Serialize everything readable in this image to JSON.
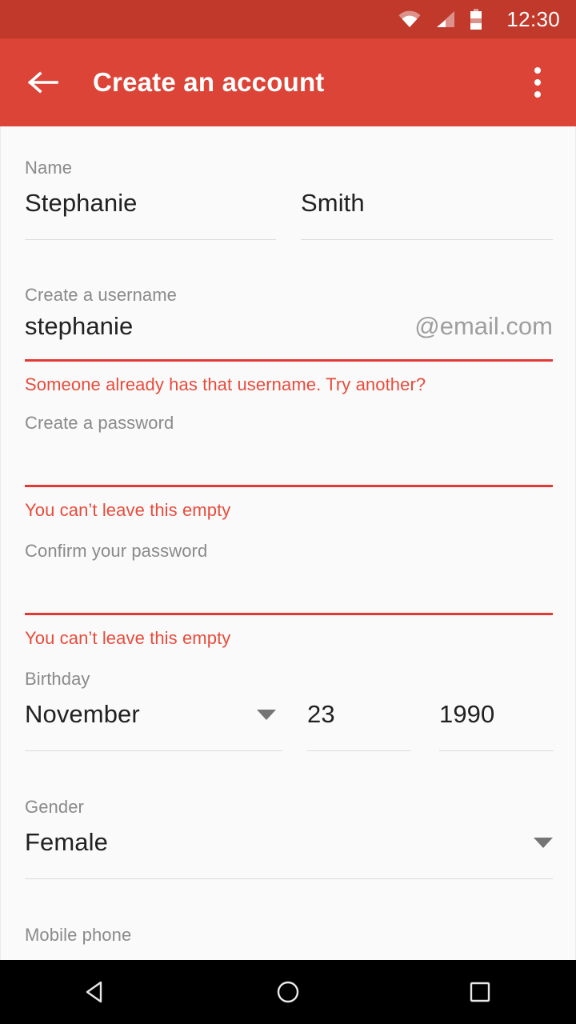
{
  "status_bar": {
    "time": "12:30",
    "background": "#c0392b",
    "icons": [
      "wifi-icon",
      "cellular-signal-icon",
      "battery-icon"
    ]
  },
  "app_bar": {
    "title": "Create an account",
    "background": "#db4437",
    "back_icon": "back-arrow-icon",
    "overflow_icon": "overflow-menu-icon"
  },
  "form": {
    "name": {
      "label": "Name",
      "first_value": "Stephanie",
      "last_value": "Smith"
    },
    "username": {
      "label": "Create a username",
      "value": "stephanie",
      "suffix": "@email.com",
      "error": "Someone already has that username. Try another?"
    },
    "password": {
      "label": "Create a password",
      "value": "",
      "error": "You can’t leave this empty"
    },
    "confirm_password": {
      "label": "Confirm your password",
      "value": "",
      "error": "You can’t leave this empty"
    },
    "birthday": {
      "label": "Birthday",
      "month": "November",
      "day": "23",
      "year": "1990"
    },
    "gender": {
      "label": "Gender",
      "value": "Female"
    },
    "mobile_phone": {
      "label": "Mobile phone"
    }
  },
  "colors": {
    "error": "#e53935",
    "accent": "#db4437",
    "label": "#8a8a8a",
    "value": "#212121",
    "underline": "#dcdcdc",
    "background": "#fafafa"
  },
  "nav_bar": {
    "back": "nav-back-icon",
    "home": "nav-home-icon",
    "recents": "nav-recents-icon"
  }
}
